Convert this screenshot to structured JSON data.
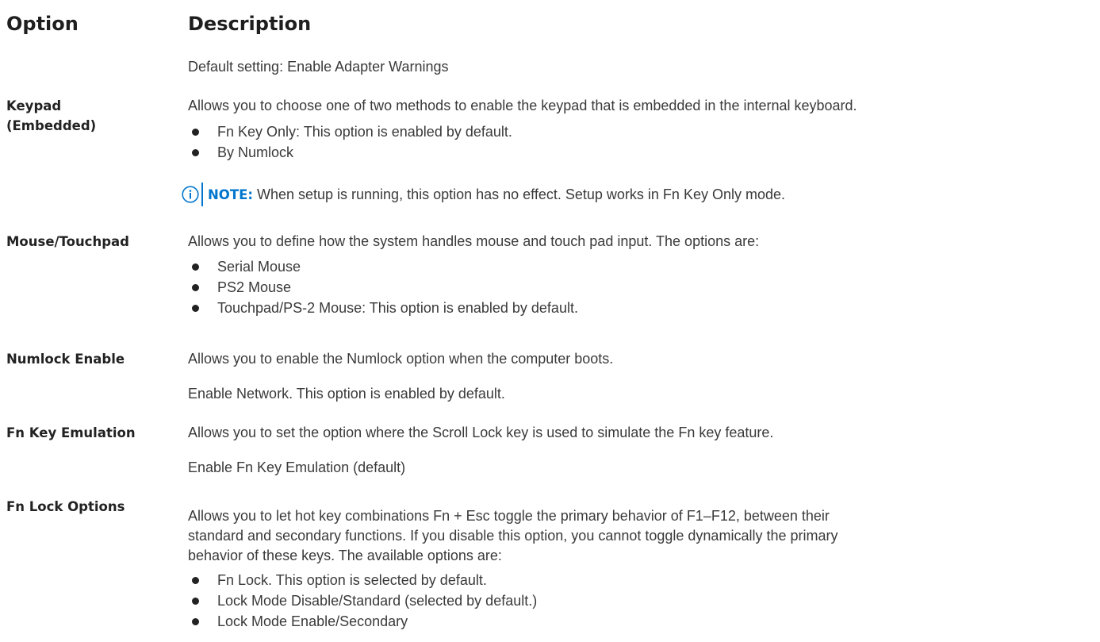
{
  "header": {
    "option": "Option",
    "description": "Description"
  },
  "adapter_warnings": {
    "default": "Default setting: Enable Adapter Warnings"
  },
  "keypad": {
    "option": "Keypad (Embedded)",
    "description": "Allows you to choose one of two methods to enable the keypad that is embedded in the internal keyboard.",
    "bullets": [
      "Fn Key Only: This option is enabled by default.",
      "By Numlock"
    ],
    "note_label": "NOTE:",
    "note_text": "When setup is running, this option has no effect. Setup works in Fn Key Only mode."
  },
  "mouse": {
    "option": "Mouse/Touchpad",
    "description": "Allows you to define how the system handles mouse and touch pad input. The options are:",
    "bullets": [
      "Serial Mouse",
      "PS2 Mouse",
      "Touchpad/PS-2 Mouse: This option is enabled by default."
    ]
  },
  "numlock": {
    "option": "Numlock Enable",
    "description": "Allows you to enable the Numlock option when the computer boots.",
    "default": "Enable Network. This option is enabled by default."
  },
  "fn_emulation": {
    "option": "Fn Key Emulation",
    "description": "Allows you to set the option where the Scroll Lock key is used to simulate the Fn key feature.",
    "default": "Enable Fn Key Emulation (default)"
  },
  "fn_lock": {
    "option": "Fn Lock Options",
    "description_lines": [
      "Allows you to let hot key combinations Fn + Esc toggle the primary behavior of F1–F12, between their",
      "standard and secondary functions. If you disable this option, you cannot toggle dynamically the primary",
      "behavior of these keys. The available options are:"
    ],
    "bullets": [
      "Fn Lock. This option is selected by default.",
      "Lock Mode Disable/Standard (selected by default.)",
      "Lock Mode Enable/Secondary"
    ]
  },
  "colors": {
    "text": "#3a3a3a",
    "heading": "#222222",
    "note_accent": "#0076ce"
  },
  "icons": {
    "note": "info-circle-icon",
    "bullet": "bullet-dot"
  }
}
